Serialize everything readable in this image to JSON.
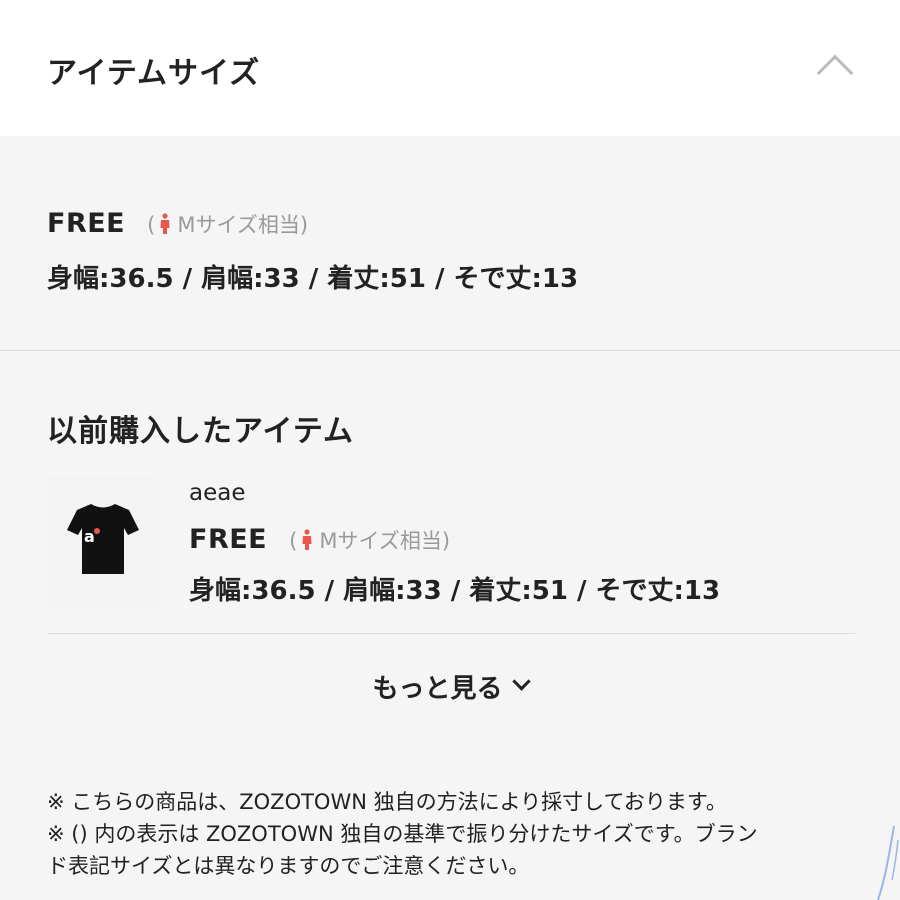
{
  "header": {
    "title": "アイテムサイズ"
  },
  "current_size": {
    "name": "FREE",
    "hint_open": "(",
    "hint": "Mサイズ相当",
    "hint_close": ")",
    "measurements": "身幅:36.5 / 肩幅:33 / 着丈:51 / そで丈:13"
  },
  "previous": {
    "title": "以前購入したアイテム",
    "item": {
      "name": "aeae",
      "size": "FREE",
      "hint_open": "(",
      "hint": "Mサイズ相当",
      "hint_close": ")",
      "measurements": "身幅:36.5 / 肩幅:33 / 着丈:51 / そで丈:13",
      "shirt_print": "a"
    }
  },
  "more_label": "もっと見る",
  "notes": [
    "※ こちらの商品は、ZOZOTOWN 独自の方法により採寸しております。",
    "※ () 内の表示は ZOZOTOWN 独自の基準で振り分けたサイズです。ブラン",
    "ド表記サイズとは異なりますのでご注意ください。"
  ],
  "colors": {
    "person_icon": "#e8584e",
    "shirt": "#111111",
    "muted_text": "#9a9a9a",
    "section_bg": "#f5f5f5"
  }
}
